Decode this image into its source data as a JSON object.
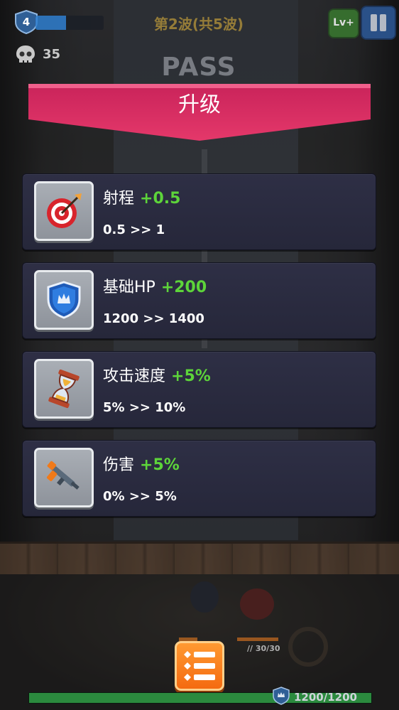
{
  "hud": {
    "player_level": "4",
    "xp_progress": 0.45,
    "kills": "35",
    "wave_text": "第2波(共5波)",
    "pass_text": "PASS",
    "lvplus_label": "Lv+"
  },
  "banner": {
    "title": "升级"
  },
  "upgrades": [
    {
      "name": "射程",
      "bonus": "+0.5",
      "change": "0.5 >> 1",
      "icon": "target-icon"
    },
    {
      "name": "基础HP",
      "bonus": "+200",
      "change": "1200 >> 1400",
      "icon": "shield-icon"
    },
    {
      "name": "攻击速度",
      "bonus": "+5%",
      "change": "5% >> 10%",
      "icon": "hourglass-icon"
    },
    {
      "name": "伤害",
      "bonus": "+5%",
      "change": "0% >> 5%",
      "icon": "gun-icon"
    }
  ],
  "bottom": {
    "ammo": "30/30",
    "base_hp": "1200/1200",
    "base_hp_fraction": 1.0
  },
  "colors": {
    "bonus": "#5dd43a",
    "banner": "#e0306a",
    "card": "#2a2b40",
    "menu_button": "#f47a1a"
  }
}
